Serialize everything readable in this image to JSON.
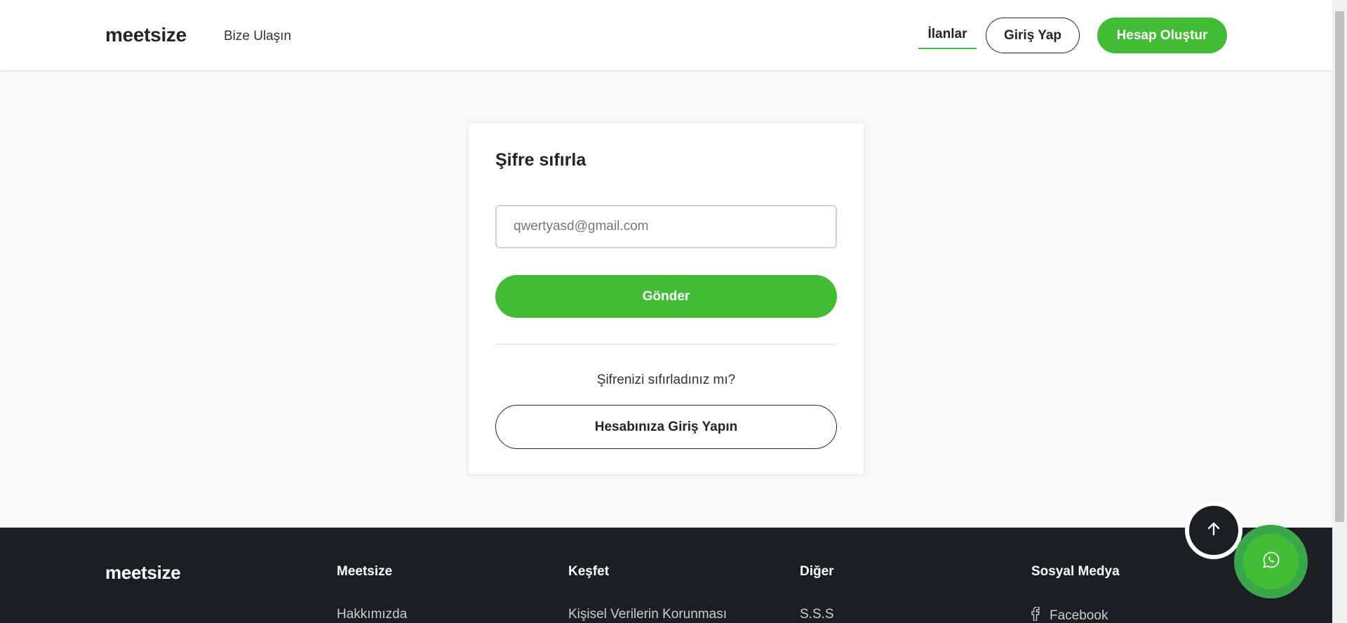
{
  "header": {
    "logo": "meetsize",
    "contact_link": "Bize Ulaşın",
    "listings_link": "İlanlar",
    "login_label": "Giriş Yap",
    "register_label": "Hesap Oluştur"
  },
  "reset_card": {
    "title": "Şifre sıfırla",
    "email_placeholder": "qwertyasd@gmail.com",
    "email_value": "",
    "send_label": "Gönder",
    "question_text": "Şifrenizi sıfırladınız mı?",
    "login_account_label": "Hesabınıza Giriş Yapın"
  },
  "footer": {
    "logo": "meetsize",
    "columns": [
      {
        "title": "Meetsize",
        "first_link": "Hakkımızda"
      },
      {
        "title": "Keşfet",
        "first_link": "Kişisel Verilerin Korunması"
      },
      {
        "title": "Diğer",
        "first_link": "S.S.S"
      },
      {
        "title": "Sosyal Medya",
        "first_link": "Facebook"
      }
    ]
  },
  "colors": {
    "accent_green": "#43bc35",
    "footer_bg": "#1b1e22",
    "page_bg": "#f8f8f8"
  },
  "icons": {
    "scroll_top": "arrow-up-icon",
    "whatsapp": "whatsapp-icon",
    "facebook": "facebook-icon"
  }
}
